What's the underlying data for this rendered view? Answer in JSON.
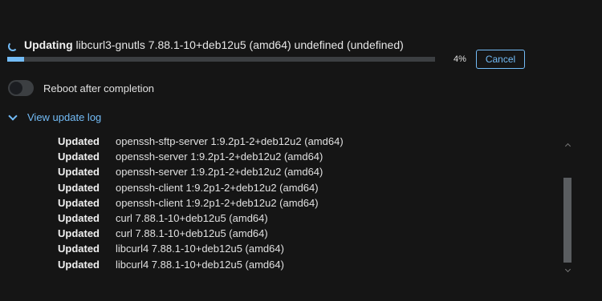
{
  "status": {
    "label": "Updating",
    "detail": "libcurl3-gnutls 7.88.1-10+deb12u5 (amd64) undefined (undefined)",
    "percent": "4%",
    "progress_fraction": 0.04
  },
  "cancel_label": "Cancel",
  "reboot": {
    "label": "Reboot after completion",
    "checked": false
  },
  "log_toggle_label": "View update log",
  "log": [
    {
      "action": "Updated",
      "package": "openssh-sftp-server 1:9.2p1-2+deb12u2 (amd64)"
    },
    {
      "action": "Updated",
      "package": "openssh-server 1:9.2p1-2+deb12u2 (amd64)"
    },
    {
      "action": "Updated",
      "package": "openssh-server 1:9.2p1-2+deb12u2 (amd64)"
    },
    {
      "action": "Updated",
      "package": "openssh-client 1:9.2p1-2+deb12u2 (amd64)"
    },
    {
      "action": "Updated",
      "package": "openssh-client 1:9.2p1-2+deb12u2 (amd64)"
    },
    {
      "action": "Updated",
      "package": "curl 7.88.1-10+deb12u5 (amd64)"
    },
    {
      "action": "Updated",
      "package": "curl 7.88.1-10+deb12u5 (amd64)"
    },
    {
      "action": "Updated",
      "package": "libcurl4 7.88.1-10+deb12u5 (amd64)"
    },
    {
      "action": "Updated",
      "package": "libcurl4 7.88.1-10+deb12u5 (amd64)"
    }
  ],
  "colors": {
    "accent": "#73bcf7",
    "background": "#151515",
    "track": "#3c3f42"
  },
  "icons": {
    "spinner": "spinner-icon",
    "chevron": "chevron-down-icon"
  }
}
